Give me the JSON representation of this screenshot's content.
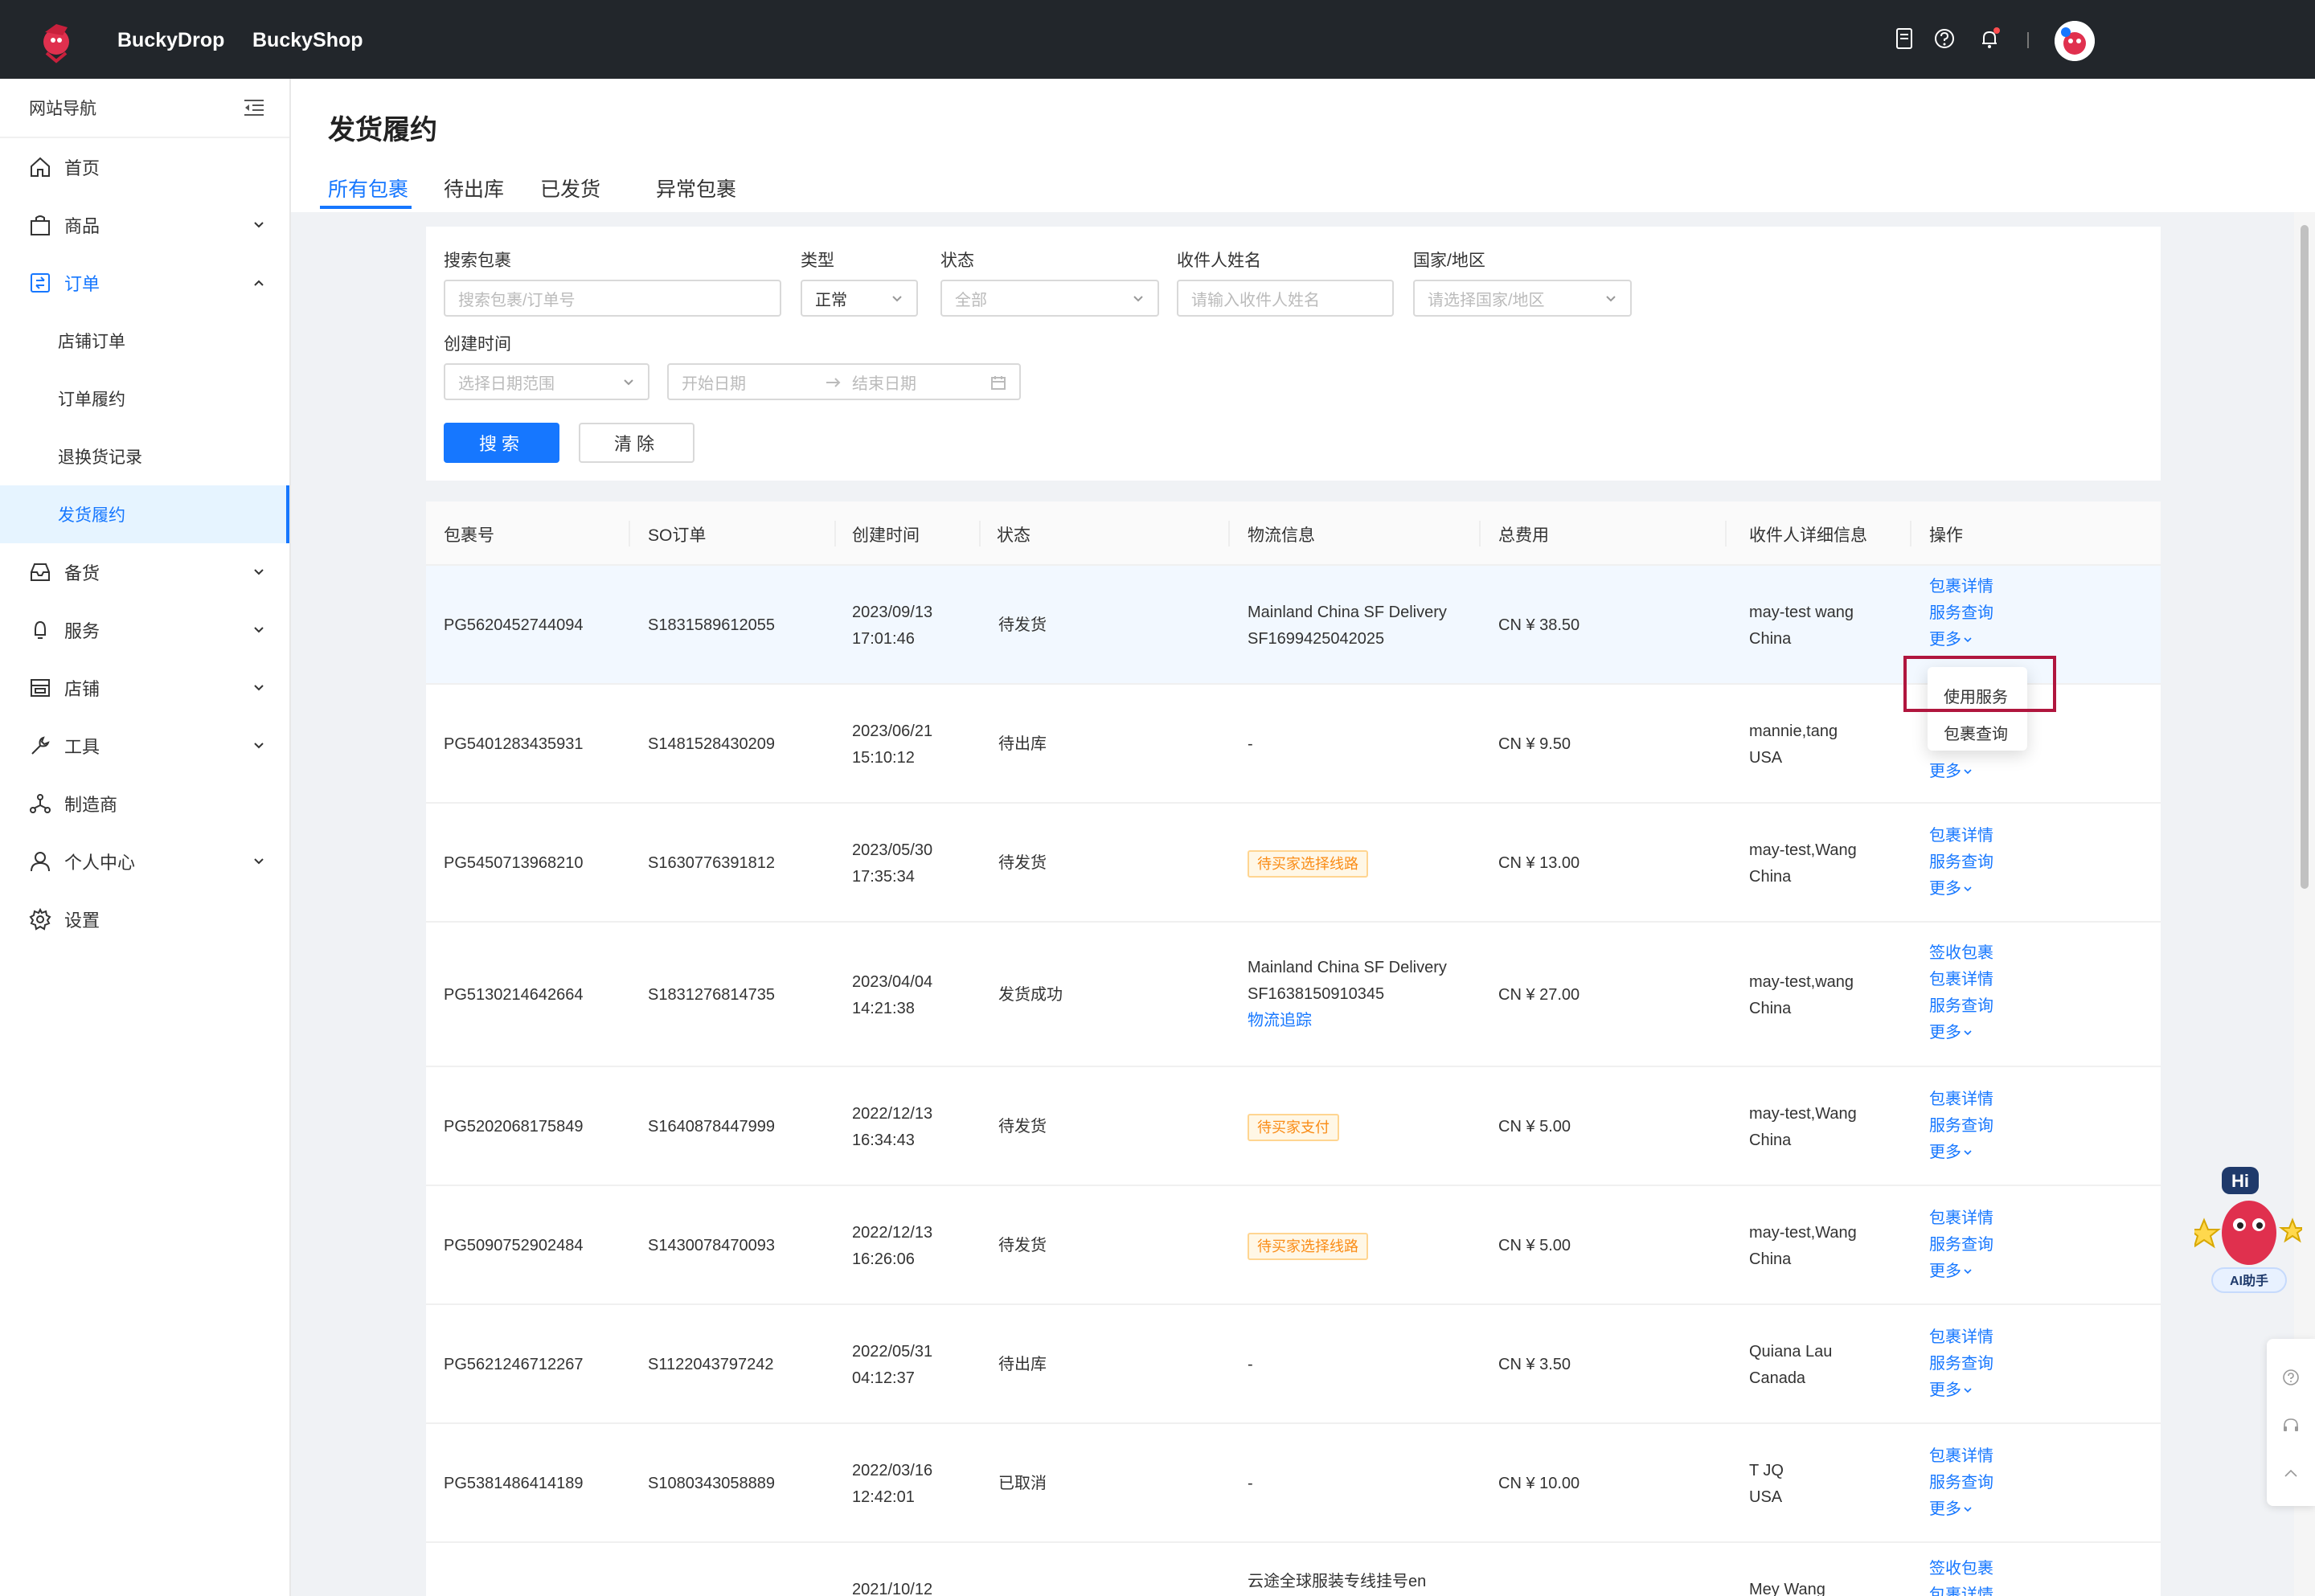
{
  "topbar": {
    "brand1": "BuckyDrop",
    "brand2": "BuckyShop",
    "icons": [
      "document-icon",
      "help-icon",
      "bell-icon"
    ]
  },
  "sidebar": {
    "header": "网站导航",
    "items": [
      {
        "label": "首页",
        "icon": "home-icon"
      },
      {
        "label": "商品",
        "icon": "bag-icon"
      },
      {
        "label": "订单",
        "icon": "order-icon"
      },
      {
        "label": "店铺订单"
      },
      {
        "label": "订单履约"
      },
      {
        "label": "退换货记录"
      },
      {
        "label": "发货履约"
      },
      {
        "label": "备货",
        "icon": "inbox-icon"
      },
      {
        "label": "服务",
        "icon": "service-icon"
      },
      {
        "label": "店铺",
        "icon": "store-icon"
      },
      {
        "label": "工具",
        "icon": "wrench-icon"
      },
      {
        "label": "制造商",
        "icon": "network-icon"
      },
      {
        "label": "个人中心",
        "icon": "user-icon"
      },
      {
        "label": "设置",
        "icon": "gear-icon"
      }
    ]
  },
  "page": {
    "title": "发货履约",
    "tabs": [
      "所有包裹",
      "待出库",
      "已发货",
      "异常包裹"
    ]
  },
  "filter": {
    "search_label": "搜索包裹",
    "search_placeholder": "搜索包裹/订单号",
    "type_label": "类型",
    "type_value": "正常",
    "status_label": "状态",
    "status_placeholder": "全部",
    "recipient_label": "收件人姓名",
    "recipient_placeholder": "请输入收件人姓名",
    "country_label": "国家/地区",
    "country_placeholder": "请选择国家/地区",
    "created_label": "创建时间",
    "range_placeholder": "选择日期范围",
    "start_placeholder": "开始日期",
    "end_placeholder": "结束日期",
    "search_button": "搜索",
    "clear_button": "清除"
  },
  "table": {
    "headers": [
      "包裹号",
      "SO订单",
      "创建时间",
      "状态",
      "物流信息",
      "总费用",
      "收件人详细信息",
      "操作"
    ],
    "rows": [
      {
        "pkg": "PG5620452744094",
        "so": "S1831589612055",
        "date": "2023/09/13",
        "time": "17:01:46",
        "status": "待发货",
        "logi1": "Mainland China SF Delivery",
        "logi2": "SF1699425042025",
        "fee": "CN ¥ 38.50",
        "name": "may-test wang",
        "country": "China",
        "ops": [
          "包裹详情",
          "服务查询",
          "更多"
        ]
      },
      {
        "pkg": "PG5401283435931",
        "so": "S1481528430209",
        "date": "2023/06/21",
        "time": "15:10:12",
        "status": "待出库",
        "logi1": "-",
        "fee": "CN ¥ 9.50",
        "name": "mannie,tang",
        "country": "USA",
        "ops": [
          "更多"
        ]
      },
      {
        "pkg": "PG5450713968210",
        "so": "S1630776391812",
        "date": "2023/05/30",
        "time": "17:35:34",
        "status": "待发货",
        "tag": "待买家选择线路",
        "fee": "CN ¥ 13.00",
        "name": "may-test,Wang",
        "country": "China",
        "ops": [
          "包裹详情",
          "服务查询",
          "更多"
        ]
      },
      {
        "pkg": "PG5130214642664",
        "so": "S1831276814735",
        "date": "2023/04/04",
        "time": "14:21:38",
        "status": "发货成功",
        "logi1": "Mainland China SF Delivery",
        "logi2": "SF1638150910345",
        "logi3": "物流追踪",
        "fee": "CN ¥ 27.00",
        "name": "may-test,wang",
        "country": "China",
        "ops": [
          "签收包裹",
          "包裹详情",
          "服务查询",
          "更多"
        ]
      },
      {
        "pkg": "PG5202068175849",
        "so": "S1640878447999",
        "date": "2022/12/13",
        "time": "16:34:43",
        "status": "待发货",
        "tag": "待买家支付",
        "fee": "CN ¥ 5.00",
        "name": "may-test,Wang",
        "country": "China",
        "ops": [
          "包裹详情",
          "服务查询",
          "更多"
        ]
      },
      {
        "pkg": "PG5090752902484",
        "so": "S1430078470093",
        "date": "2022/12/13",
        "time": "16:26:06",
        "status": "待发货",
        "tag": "待买家选择线路",
        "fee": "CN ¥ 5.00",
        "name": "may-test,Wang",
        "country": "China",
        "ops": [
          "包裹详情",
          "服务查询",
          "更多"
        ]
      },
      {
        "pkg": "PG5621246712267",
        "so": "S1122043797242",
        "date": "2022/05/31",
        "time": "04:12:37",
        "status": "待出库",
        "logi1": "-",
        "fee": "CN ¥ 3.50",
        "name": "Quiana Lau",
        "country": "Canada",
        "ops": [
          "包裹详情",
          "服务查询",
          "更多"
        ]
      },
      {
        "pkg": "PG5381486414189",
        "so": "S1080343058889",
        "date": "2022/03/16",
        "time": "12:42:01",
        "status": "已取消",
        "logi1": "-",
        "fee": "CN ¥ 10.00",
        "name": "T JQ",
        "country": "USA",
        "ops": [
          "包裹详情",
          "服务查询",
          "更多"
        ]
      },
      {
        "pkg": "",
        "so": "",
        "date": "2021/10/12",
        "time": "",
        "status": "",
        "logi1": "云途全球服装专线挂号en",
        "fee": "",
        "name": "Mey Wang",
        "country": "",
        "ops": [
          "签收包裹",
          "包裹详情"
        ]
      }
    ]
  },
  "dropdown": {
    "items": [
      "使用服务",
      "包裹查询"
    ]
  },
  "ai_helper": {
    "badge": "Hi",
    "label": "AI助手"
  },
  "colors": {
    "primary": "#1677ff",
    "topbar": "#22262b",
    "tag_orange": "#fa8c16",
    "highlight": "#b0163e"
  }
}
